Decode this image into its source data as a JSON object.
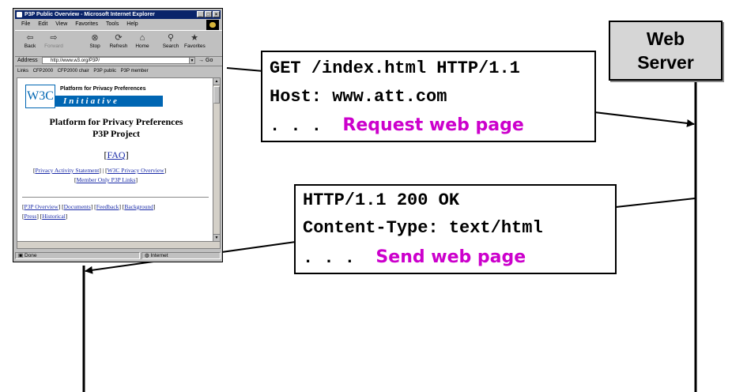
{
  "browser": {
    "window_title": "P3P Public Overview - Microsoft Internet Explorer",
    "window_buttons": [
      "_",
      "□",
      "×"
    ],
    "menu": [
      "File",
      "Edit",
      "View",
      "Favorites",
      "Tools",
      "Help"
    ],
    "toolbar": [
      {
        "label": "Back",
        "icon": "back-arrow-icon",
        "glyph": "⇦"
      },
      {
        "label": "Forward",
        "icon": "forward-arrow-icon",
        "glyph": "⇨"
      },
      {
        "label": "Stop",
        "icon": "stop-icon",
        "glyph": "⊗"
      },
      {
        "label": "Refresh",
        "icon": "refresh-icon",
        "glyph": "⟳"
      },
      {
        "label": "Home",
        "icon": "home-icon",
        "glyph": "⌂"
      },
      {
        "label": "Search",
        "icon": "search-icon",
        "glyph": "⚲"
      },
      {
        "label": "Favorites",
        "icon": "favorites-icon",
        "glyph": "★"
      }
    ],
    "address_label": "Address",
    "address_value": "http://www.w3.org/P3P/",
    "go_label": "Go",
    "links_label": "Links",
    "links": [
      "CFP2000",
      "CFP2000 chair",
      "P3P public",
      "P3P member"
    ],
    "status_text": "Done",
    "status_zone": "Internet",
    "page": {
      "logo_text": "W3C",
      "logo_title": "Platform for Privacy Preferences",
      "logo_band": "Initiative",
      "heading_line1": "Platform for Privacy Preferences",
      "heading_line2": "P3P Project",
      "faq": "FAQ",
      "row1_link1": "Privacy Activity Statement",
      "row1_link2": "W3C Privacy Overview",
      "row2_link": "Member Only P3P Links",
      "nav_links": [
        "P3P Overview",
        "Documents",
        "Feedback",
        "Background"
      ],
      "nav_links2": [
        "Press",
        "Historical"
      ]
    }
  },
  "server": {
    "label_line1": "Web",
    "label_line2": "Server"
  },
  "request": {
    "line1": "GET /index.html HTTP/1.1",
    "line2": "Host: www.att.com",
    "dots": ". . .",
    "caption": "Request web page"
  },
  "response": {
    "line1": "HTTP/1.1 200 OK",
    "line2": "Content-Type: text/html",
    "dots": ". . .",
    "caption": "Send web page"
  },
  "colors": {
    "caption": "#cc00cc",
    "server_fill": "#d6d6d6",
    "titlebar": "#0a246a"
  }
}
